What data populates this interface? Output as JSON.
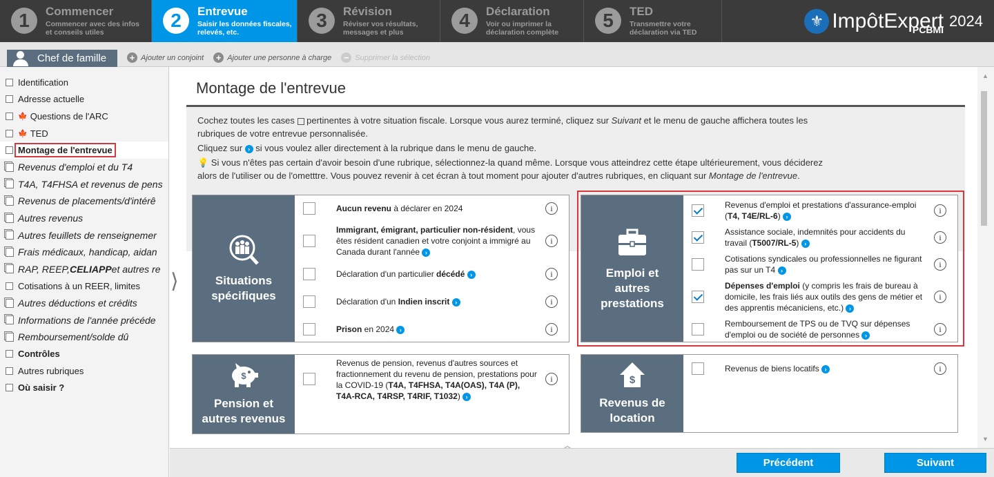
{
  "steps": [
    {
      "num": "1",
      "title": "Commencer",
      "sub1": "Commencer avec des infos",
      "sub2": "et conseils utiles"
    },
    {
      "num": "2",
      "title": "Entrevue",
      "sub1": "Saisir les données fiscales,",
      "sub2": "relevés, etc."
    },
    {
      "num": "3",
      "title": "Révision",
      "sub1": "Réviser vos résultats,",
      "sub2": "messages et plus"
    },
    {
      "num": "4",
      "title": "Déclaration",
      "sub1": "Voir ou imprimer la",
      "sub2": "déclaration complète"
    },
    {
      "num": "5",
      "title": "TED",
      "sub1": "Transmettre votre",
      "sub2": "déclaration via TED"
    }
  ],
  "brand": {
    "name": "ImpôtExpert",
    "sub": "PCBMI",
    "year": "2024"
  },
  "subbar": {
    "person": "Chef de famille",
    "add_spouse": "Ajouter un conjoint",
    "add_dependent": "Ajouter une personne à charge",
    "delete": "Supprimer la sélection"
  },
  "sidebar": [
    "Identification",
    "Adresse actuelle",
    "Questions de l'ARC",
    "TED",
    "Montage de l'entrevue",
    "Revenus d'emploi et du T4",
    "T4A, T4FHSA et revenus de pens",
    "Revenus de placements/d'intérê",
    "Autres revenus",
    "Autres feuillets de renseignemer",
    "Frais médicaux, handicap, aidan",
    "RAP, REEP, ",
    "Cotisations à un REER, limites",
    "Autres déductions et crédits",
    "Informations de l'année précéde",
    "Remboursement/solde dû",
    "Contrôles",
    "Autres rubriques",
    "Où saisir ?"
  ],
  "sidebar_rap_bold": "CELIAPP",
  "sidebar_rap_tail": " et autres re",
  "main": {
    "title": "Montage de l'entrevue",
    "intro1a": "Cochez toutes les cases",
    "intro1b": " pertinentes à votre situation fiscale. Lorsque vous aurez terminé, cliquez sur ",
    "intro1c": "Suivant",
    "intro1d": " et le menu de gauche affichera toutes les",
    "intro1e": "rubriques de votre entrevue personnalisée.",
    "intro2a": "Cliquez sur ",
    "intro2b": " si vous voulez aller directement à la rubrique dans le menu de gauche.",
    "intro3a": " Si vous n'êtes pas certain d'avoir besoin d'une rubrique, sélectionnez-la quand même. Lorsque vous atteindrez cette étape ultérieurement, vous déciderez",
    "intro3b": "alors de l'utiliser ou de l'ometttre. Vous pouvez revenir à cet écran à tout moment pour ajouter d'autres rubriques, en cliquant sur ",
    "intro3c": "Montage de l'entrevue",
    "intro3d": "."
  },
  "cards": {
    "situations": {
      "title1": "Situations",
      "title2": "spécifiques",
      "rows": [
        {
          "b": "Aucun revenu",
          "t": " à déclarer en 2024"
        },
        {
          "b": "Immigrant, émigrant, particulier non-résident",
          "t": ", vous êtes résident canadien et votre conjoint a immigré au Canada durant l'année"
        },
        {
          "pre": "Déclaration d'un particulier ",
          "b": "décédé"
        },
        {
          "pre": "Déclaration d'un ",
          "b": "Indien inscrit"
        },
        {
          "b": "Prison",
          "t": " en 2024"
        }
      ]
    },
    "emploi": {
      "title1": "Emploi et",
      "title2": "autres",
      "title3": "prestations",
      "rows": [
        {
          "t": "Revenus d'emploi et prestations d'assurance-emploi (",
          "b": "T4, T4E/RL-6",
          "t2": ")",
          "checked": true
        },
        {
          "t": "Assistance sociale, indemnités pour accidents du travail (",
          "b": "T5007/RL-5",
          "t2": ")",
          "checked": true
        },
        {
          "t": "Cotisations syndicales ou professionnelles ne figurant pas sur un T4",
          "checked": false
        },
        {
          "b": "Dépenses d'emploi",
          "t": " (y compris les frais de bureau à domicile, les frais liés aux outils des gens de métier et des apprentis mécaniciens, etc.)",
          "checked": true
        },
        {
          "t": "Remboursement de TPS ou de TVQ sur dépenses d'emploi ou de société de personnes",
          "checked": false
        }
      ]
    },
    "pension": {
      "title1": "Pension et",
      "title2": "autres revenus",
      "row_t": "Revenus de pension, revenus d'autres sources et fractionnement du revenu de pension, prestations pour la COVID-19 (",
      "row_b": "T4A, T4FHSA, T4A(OAS), T4A (P), T4A-RCA, T4RSP, T4RIF, T1032",
      "row_t2": ")"
    },
    "location": {
      "title1": "Revenus de",
      "title2": "location",
      "row_t": "Revenus de biens locatifs"
    }
  },
  "footer": {
    "prev": "Précédent",
    "next": "Suivant"
  }
}
